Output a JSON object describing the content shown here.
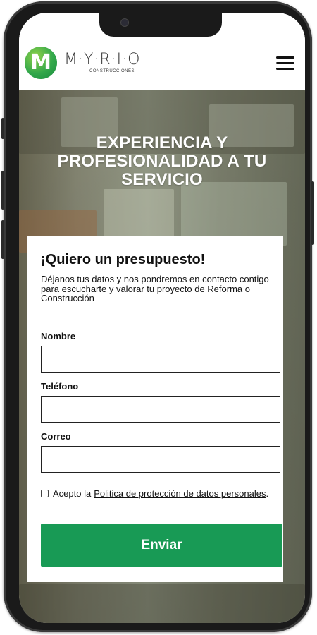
{
  "header": {
    "logo_letter": "M",
    "brand_name": "M·Y·R·I·O",
    "brand_subtitle": "CONSTRUCCIONES"
  },
  "hero": {
    "title": "EXPERIENCIA Y PROFESIONALIDAD A TU SERVICIO"
  },
  "form": {
    "title": "¡Quiero un presupuesto!",
    "description": "Déjanos tus datos y nos pondremos en contacto contigo para escucharte y valorar tu proyecto de Reforma o Construcción",
    "fields": [
      {
        "label": "Nombre",
        "value": ""
      },
      {
        "label": "Teléfono",
        "value": ""
      },
      {
        "label": "Correo",
        "value": ""
      }
    ],
    "consent_prefix": "Acepto la",
    "consent_link": "Politica de protección de datos personales",
    "consent_suffix": ".",
    "consent_checked": false,
    "submit_label": "Enviar"
  },
  "colors": {
    "brand_green": "#189a55",
    "logo_green": "#33a84b",
    "phone_frame": "#1a1a1a"
  },
  "icons": [
    "hamburger-menu-icon",
    "camera-icon",
    "checkbox-icon"
  ]
}
